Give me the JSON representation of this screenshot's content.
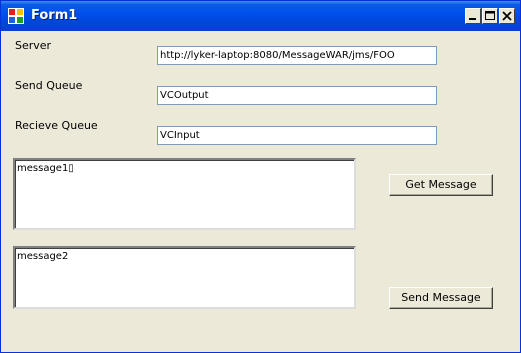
{
  "window": {
    "title": "Form1"
  },
  "form": {
    "server_label": "Server",
    "server_value": "http://lyker-laptop:8080/MessageWAR/jms/FOO",
    "send_queue_label": "Send Queue",
    "send_queue_value": "VCOutput",
    "receive_queue_label": "Recieve Queue",
    "receive_queue_value": "VCInput",
    "message1_text": "message1▯",
    "message2_text": "message2",
    "get_button_label": "Get Message",
    "send_button_label": "Send Message"
  },
  "icons": {
    "app": "form-icon",
    "minimize": "minimize-icon",
    "maximize": "maximize-icon",
    "close": "close-icon"
  }
}
